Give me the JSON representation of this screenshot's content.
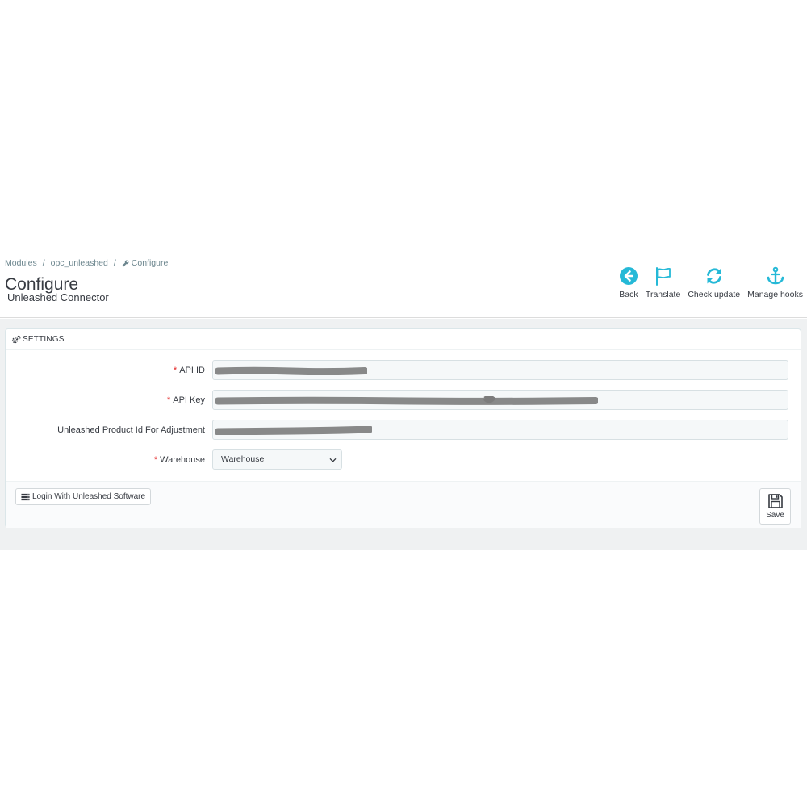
{
  "breadcrumb": {
    "items": [
      "Modules",
      "opc_unleashed",
      "Configure"
    ],
    "separator": "/"
  },
  "page": {
    "title": "Configure",
    "subtitle": "Unleashed Connector"
  },
  "toolbar": {
    "buttons": [
      {
        "label": "Back",
        "icon": "circle-arrow-left-icon"
      },
      {
        "label": "Translate",
        "icon": "flag-icon"
      },
      {
        "label": "Check update",
        "icon": "refresh-icon"
      },
      {
        "label": "Manage hooks",
        "icon": "anchor-icon"
      }
    ],
    "accent_color": "#25b9d7"
  },
  "settings": {
    "heading": "SETTINGS",
    "fields": [
      {
        "label": "API ID",
        "required": true,
        "value": ""
      },
      {
        "label": "API Key",
        "required": true,
        "value": ""
      },
      {
        "label": "Unleashed Product Id For Adjustment",
        "required": false,
        "value": ""
      },
      {
        "label": "Warehouse",
        "required": true,
        "selected": "Warehouse"
      }
    ],
    "required_marker": "*",
    "required_color": "#e32020"
  },
  "footer": {
    "login_label": "Login With Unleashed Software",
    "save_label": "Save"
  }
}
